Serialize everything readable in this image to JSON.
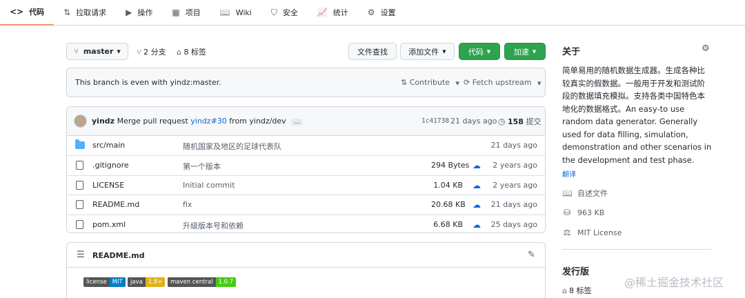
{
  "nav": [
    {
      "icon": "<>",
      "label": "代码",
      "active": true,
      "icon_name": "code-icon"
    },
    {
      "icon": "⇅",
      "label": "拉取请求",
      "icon_name": "pull-request-icon"
    },
    {
      "icon": "▶",
      "label": "操作",
      "icon_name": "actions-icon"
    },
    {
      "icon": "▦",
      "label": "项目",
      "icon_name": "projects-icon"
    },
    {
      "icon": "📖",
      "label": "Wiki",
      "icon_name": "wiki-book-icon"
    },
    {
      "icon": "⛉",
      "label": "安全",
      "icon_name": "shield-icon"
    },
    {
      "icon": "📈",
      "label": "统计",
      "icon_name": "graph-icon"
    },
    {
      "icon": "⚙",
      "label": "设置",
      "icon_name": "gear-icon"
    }
  ],
  "toolbar": {
    "branch": "master",
    "branches": "2 分支",
    "tags": "8 标签",
    "find_file": "文件查找",
    "add_file": "添加文件",
    "code": "代码",
    "accelerate": "加速"
  },
  "branch_status": {
    "text": "This branch is even with yindz:master.",
    "contribute": "Contribute",
    "fetch": "Fetch upstream"
  },
  "commit": {
    "author": "yindz",
    "message_prefix": "Merge pull request",
    "pr_link": "yindz#30",
    "message_suffix": "from yindz/dev",
    "ellipsis": "…",
    "hash": "1c41738",
    "time": "21 days ago",
    "count": "158",
    "count_label": "提交"
  },
  "files": [
    {
      "type": "folder",
      "name": "src/main",
      "message": "随机国家及地区的足球代表队",
      "size": "",
      "time": "21 days ago"
    },
    {
      "type": "file",
      "name": ".gitignore",
      "message": "第一个版本",
      "size": "294 Bytes",
      "time": "2 years ago"
    },
    {
      "type": "file",
      "name": "LICENSE",
      "message": "Initial commit",
      "size": "1.04 KB",
      "time": "2 years ago"
    },
    {
      "type": "file",
      "name": "README.md",
      "message": "fix",
      "size": "20.68 KB",
      "time": "21 days ago"
    },
    {
      "type": "file",
      "name": "pom.xml",
      "message": "升级版本号和依赖",
      "size": "6.68 KB",
      "time": "25 days ago"
    }
  ],
  "readme": {
    "title": "README.md",
    "badges": [
      {
        "k": "license",
        "v": "MIT",
        "color": "#007ec6"
      },
      {
        "k": "java",
        "v": "1.8+",
        "color": "#dfb317"
      },
      {
        "k": "maven central",
        "v": "1.0.7",
        "color": "#4c1"
      }
    ]
  },
  "about": {
    "title": "关于",
    "description": "简单易用的随机数据生成器。生成各种比较真实的假数据。一般用于开发和测试阶段的数据填充模拟。支持各类中国特色本地化的数据格式。An easy-to use random data generator. Generally used for data filling, simulation, demonstration and other scenarios in the development and test phase.",
    "translate": "翻译",
    "readme": "自述文件",
    "size": "963 KB",
    "license": "MIT License"
  },
  "releases": {
    "title": "发行版",
    "tags": "8 标签"
  },
  "watermark": "@稀土掘金技术社区",
  "colors": {
    "green": "#2da44e",
    "link": "#0969da",
    "active_tab": "#fd8c73"
  }
}
